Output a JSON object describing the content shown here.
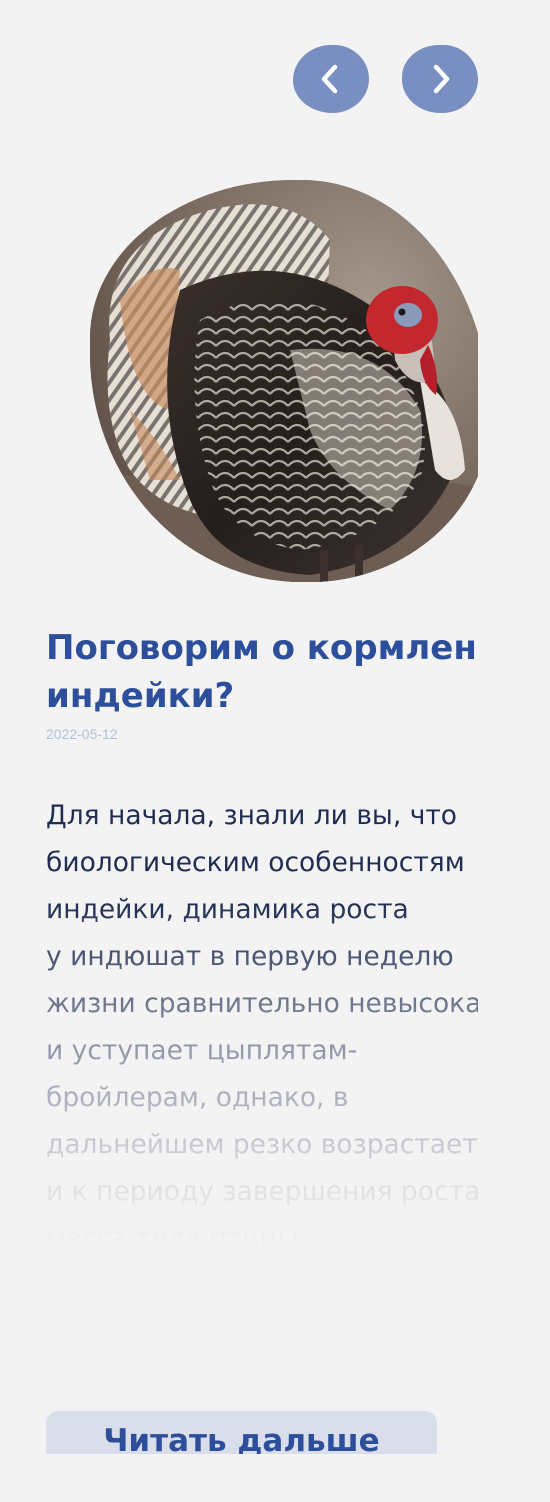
{
  "navigation": {
    "prev_icon": "chevron-left-icon",
    "next_icon": "chevron-right-icon",
    "button_color": "#7a8fc1"
  },
  "article": {
    "image_subject": "turkey",
    "title_lines": [
      "Поговорим о кормлении",
      "индейки?"
    ],
    "date": "2022-05-12",
    "excerpt_lines": [
      "Для начала, знали ли вы, что",
      "биологическим особенностям",
      "индейки, динамика роста",
      "у индюшат в первую неделю",
      "жизни сравнительно невысокая",
      "и уступает цыплятам-",
      "бройлерам, однако, в",
      "дальнейшем резко возрастает",
      "и к периоду завершения роста",
      "масса тела птицы"
    ],
    "read_more_label": "Читать дальше"
  },
  "colors": {
    "accent": "#2d4e9b",
    "text": "#1f2d52",
    "date": "#b4bfdc",
    "background": "#f4f3f3",
    "button_bg": "#d9deea"
  }
}
